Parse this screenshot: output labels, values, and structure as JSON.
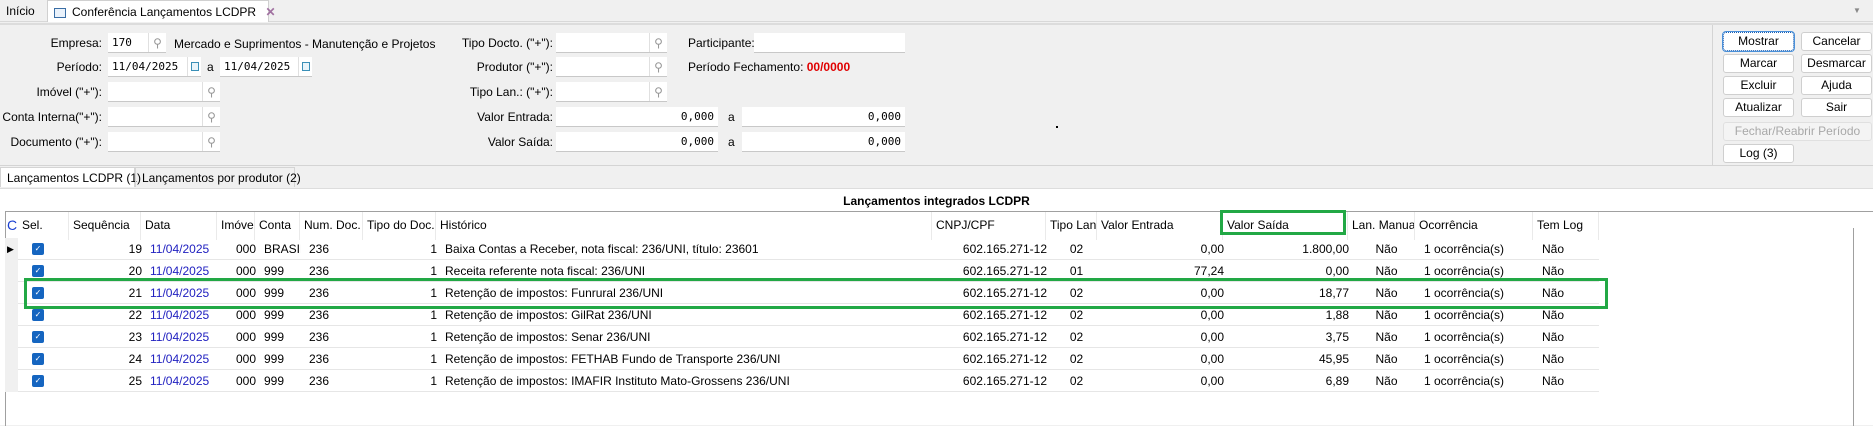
{
  "tabs": {
    "home": "Início",
    "current": "Conferência Lançamentos LCDPR"
  },
  "filters": {
    "empresa_label": "Empresa:",
    "empresa_value": "170",
    "empresa_name": "Mercado e Suprimentos - Manutenção e Projetos",
    "periodo_label": "Período:",
    "periodo_from": "11/04/2025",
    "periodo_sep": "a",
    "periodo_to": "11/04/2025",
    "imovel_label": "Imóvel (\"+\"):",
    "imovel_value": "",
    "conta_label": "Conta Interna(\"+\"):",
    "conta_value": "",
    "documento_label": "Documento (\"+\"):",
    "documento_value": "",
    "tipo_docto_label": "Tipo Docto. (\"+\"):",
    "tipo_docto_value": "",
    "produtor_label": "Produtor (\"+\"):",
    "produtor_value": "",
    "tipo_lan_label": "Tipo Lan.: (\"+\"):",
    "tipo_lan_value": "",
    "valor_entrada_label": "Valor Entrada:",
    "valor_entrada_from": "0,000",
    "valor_entrada_sep": "a",
    "valor_entrada_to": "0,000",
    "valor_saida_label": "Valor Saída:",
    "valor_saida_from": "0,000",
    "valor_saida_sep": "a",
    "valor_saida_to": "0,000",
    "participante_label": "Participante:",
    "participante_value": "",
    "periodo_fechamento_label": "Período Fechamento:",
    "periodo_fechamento_value": "00/0000"
  },
  "buttons": {
    "mostrar": "Mostrar",
    "cancelar": "Cancelar",
    "marcar": "Marcar",
    "desmarcar": "Desmarcar",
    "excluir": "Excluir",
    "ajuda": "Ajuda",
    "atualizar": "Atualizar",
    "sair": "Sair",
    "fechar_reabrir": "Fechar/Reabrir Período",
    "log": "Log (3)"
  },
  "subtabs": {
    "lcdpr": "Lançamentos LCDPR (1)",
    "produtor": "Lançamentos por produtor (2)"
  },
  "grid": {
    "title": "Lançamentos integrados LCDPR",
    "corner": "C",
    "headers": [
      "Sel.",
      "Sequência",
      "Data",
      "Imóvel",
      "Conta",
      "Num. Doc.",
      "Tipo do Doc.",
      "Histórico",
      "CNPJ/CPF",
      "Tipo Lan.",
      "Valor Entrada",
      "Valor Saída",
      "Lan. Manual",
      "Ocorrência",
      "Tem Log"
    ],
    "rows": [
      {
        "seq": "19",
        "data": "11/04/2025",
        "imovel": "000",
        "conta": "BRASIL",
        "num_doc": "236",
        "tipo_doc": "1",
        "historico": "Baixa Contas a Receber, nota fiscal: 236/UNI, título: 23601",
        "cnpj": "602.165.271-12",
        "tipo_lan": "02",
        "valor_entrada": "0,00",
        "valor_saida": "1.800,00",
        "lan_manual": "Não",
        "ocorrencia": "1 ocorrência(s)",
        "tem_log": "Não",
        "selected": true,
        "current": true
      },
      {
        "seq": "20",
        "data": "11/04/2025",
        "imovel": "000",
        "conta": "999",
        "num_doc": "236",
        "tipo_doc": "1",
        "historico": "Receita referente nota fiscal: 236/UNI",
        "cnpj": "602.165.271-12",
        "tipo_lan": "01",
        "valor_entrada": "77,24",
        "valor_saida": "0,00",
        "lan_manual": "Não",
        "ocorrencia": "1 ocorrência(s)",
        "tem_log": "Não",
        "selected": true
      },
      {
        "seq": "21",
        "data": "11/04/2025",
        "imovel": "000",
        "conta": "999",
        "num_doc": "236",
        "tipo_doc": "1",
        "historico": "Retenção de impostos: Funrural 236/UNI",
        "cnpj": "602.165.271-12",
        "tipo_lan": "02",
        "valor_entrada": "0,00",
        "valor_saida": "18,77",
        "lan_manual": "Não",
        "ocorrencia": "1 ocorrência(s)",
        "tem_log": "Não",
        "selected": true,
        "highlighted": true
      },
      {
        "seq": "22",
        "data": "11/04/2025",
        "imovel": "000",
        "conta": "999",
        "num_doc": "236",
        "tipo_doc": "1",
        "historico": "Retenção de impostos: GilRat 236/UNI",
        "cnpj": "602.165.271-12",
        "tipo_lan": "02",
        "valor_entrada": "0,00",
        "valor_saida": "1,88",
        "lan_manual": "Não",
        "ocorrencia": "1 ocorrência(s)",
        "tem_log": "Não",
        "selected": true
      },
      {
        "seq": "23",
        "data": "11/04/2025",
        "imovel": "000",
        "conta": "999",
        "num_doc": "236",
        "tipo_doc": "1",
        "historico": "Retenção de impostos: Senar 236/UNI",
        "cnpj": "602.165.271-12",
        "tipo_lan": "02",
        "valor_entrada": "0,00",
        "valor_saida": "3,75",
        "lan_manual": "Não",
        "ocorrencia": "1 ocorrência(s)",
        "tem_log": "Não",
        "selected": true
      },
      {
        "seq": "24",
        "data": "11/04/2025",
        "imovel": "000",
        "conta": "999",
        "num_doc": "236",
        "tipo_doc": "1",
        "historico": "Retenção de impostos: FETHAB Fundo de Transporte 236/UNI",
        "cnpj": "602.165.271-12",
        "tipo_lan": "02",
        "valor_entrada": "0,00",
        "valor_saida": "45,95",
        "lan_manual": "Não",
        "ocorrencia": "1 ocorrência(s)",
        "tem_log": "Não",
        "selected": true
      },
      {
        "seq": "25",
        "data": "11/04/2025",
        "imovel": "000",
        "conta": "999",
        "num_doc": "236",
        "tipo_doc": "1",
        "historico": "Retenção de impostos: IMAFIR Instituto Mato-Grossens 236/UNI",
        "cnpj": "602.165.271-12",
        "tipo_lan": "02",
        "valor_entrada": "0,00",
        "valor_saida": "6,89",
        "lan_manual": "Não",
        "ocorrencia": "1 ocorrência(s)",
        "tem_log": "Não",
        "selected": true
      }
    ]
  },
  "colors": {
    "highlight": "#22a845",
    "red": "#e00000",
    "date": "#2020c0",
    "checkbox": "#1565c0"
  }
}
